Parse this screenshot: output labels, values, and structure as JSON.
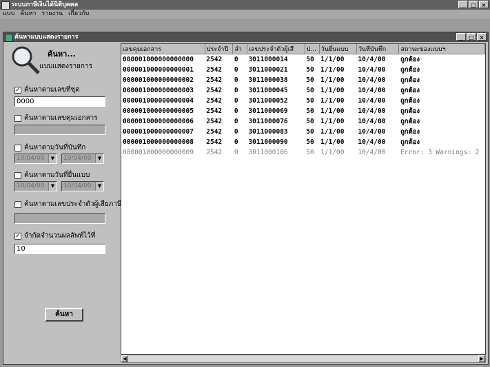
{
  "app": {
    "title": "ระบบภาษีเงินได้นิติบุคคล"
  },
  "menu": [
    "แบบ",
    "ค้นหา",
    "รายงาน",
    "เกี่ยวกับ"
  ],
  "window": {
    "title": "ค้นหาแบบแสดงรายการ"
  },
  "search": {
    "title": "ค้นหา...",
    "subtitle": "แบบแสดงรายการ",
    "by_batch_label": "ค้นหาตามเลขที่ชุด",
    "by_batch_value": "0000",
    "by_docno_label": "ค้นหาตามเลขคุมเอกสาร",
    "by_record_date_label": "ค้นหาตามวันที่บันทึก",
    "record_date_from": "10/04/00",
    "record_date_to": "10/04/00",
    "by_submit_date_label": "ค้นหาตามวันที่ยื่นแบบ",
    "submit_date_from": "10/04/00",
    "submit_date_to": "10/04/00",
    "by_taxid_label": "ค้นหาตามเลขประจำตัวผู้เสียภาษี",
    "limit_label": "จำกัดจำนวนผลลัพท์ไว้ที่",
    "limit_value": "10",
    "search_button": "ค้นหา"
  },
  "table": {
    "columns": [
      "เลขคุมเอกสาร",
      "ประจำปี",
      "ลำ",
      "เลขประจำตัวผู้เสี",
      "ป...",
      "วันยื่นแบบ",
      "วันที่บันทึก",
      "สถานะของแบบฯ"
    ],
    "rows": [
      [
        "000001000000000000",
        "2542",
        "0",
        "3011000014",
        "50",
        "1/1/00",
        "10/4/00",
        "ถูกต้อง"
      ],
      [
        "000001000000000001",
        "2542",
        "0",
        "3011000021",
        "50",
        "1/1/00",
        "10/4/00",
        "ถูกต้อง"
      ],
      [
        "000001000000000002",
        "2542",
        "0",
        "3011000038",
        "50",
        "1/1/00",
        "10/4/00",
        "ถูกต้อง"
      ],
      [
        "000001000000000003",
        "2542",
        "0",
        "3011000045",
        "50",
        "1/1/00",
        "10/4/00",
        "ถูกต้อง"
      ],
      [
        "000001000000000004",
        "2542",
        "0",
        "3011000052",
        "50",
        "1/1/00",
        "10/4/00",
        "ถูกต้อง"
      ],
      [
        "000001000000000005",
        "2542",
        "0",
        "3011000069",
        "50",
        "1/1/00",
        "10/4/00",
        "ถูกต้อง"
      ],
      [
        "000001000000000006",
        "2542",
        "0",
        "3011000076",
        "50",
        "1/1/00",
        "10/4/00",
        "ถูกต้อง"
      ],
      [
        "000001000000000007",
        "2542",
        "0",
        "3011000083",
        "50",
        "1/1/00",
        "10/4/00",
        "ถูกต้อง"
      ],
      [
        "000001000000000008",
        "2542",
        "0",
        "3011000090",
        "50",
        "1/1/00",
        "10/4/00",
        "ถูกต้อง"
      ],
      [
        "000001000000000009",
        "2542",
        "0",
        "3011000106",
        "50",
        "1/1/00",
        "10/4/00",
        "Error: 3 Warnings: 2"
      ]
    ]
  }
}
